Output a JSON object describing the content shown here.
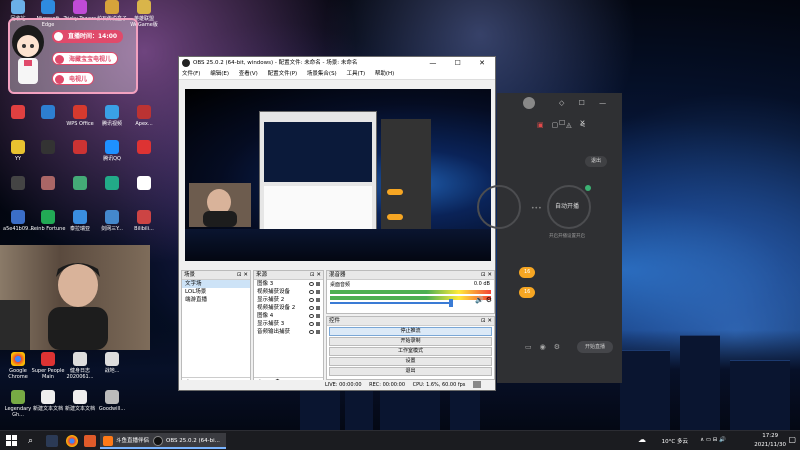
{
  "desktop": {
    "icons_col1": [
      "回收站",
      "",
      "",
      "",
      "",
      "",
      "",
      "",
      "",
      "Google Chrome",
      "Legendary Gh...",
      ""
    ],
    "icons_top": [
      {
        "label": "Microsoft Edge"
      },
      {
        "label": "Tricky Towers"
      },
      {
        "label": "炉石传说盒子"
      },
      {
        "label": "英雄联盟 WeGame版"
      },
      {
        "label": "...ubi"
      },
      {
        "label": "爱奇艺"
      },
      {
        "label": "CCleaner"
      },
      {
        "label": "同步下载客户端"
      },
      {
        "label": "打开机器"
      },
      {
        "label": "Ub..."
      }
    ],
    "icons_mid": [
      {
        "label": "WPS Office"
      },
      {
        "label": "腾讯视频"
      },
      {
        "label": "Apex..."
      },
      {
        "label": "YY"
      },
      {
        "label": "腾讯QQ"
      },
      {
        "label": "网易云..."
      },
      {
        "label": "炉石盒子"
      },
      {
        "label": "QQ音乐"
      },
      {
        "label": "a5e41b09..."
      },
      {
        "label": "Reinb Fortune"
      },
      {
        "label": "泰拉瑞亚"
      },
      {
        "label": "剑网三Y..."
      },
      {
        "label": "直播伴侣"
      },
      {
        "label": "Bilibili..."
      }
    ],
    "icons_bottom": [
      {
        "label": "Google Chrome"
      },
      {
        "label": "Super People Main"
      },
      {
        "label": "健身日志 2020061..."
      },
      {
        "label": "战地..."
      },
      {
        "label": "Legendary Gh..."
      },
      {
        "label": "新建文本文档"
      },
      {
        "label": "新建文本文档"
      },
      {
        "label": "Goodwill..."
      }
    ]
  },
  "overlay": {
    "time_text": "直播时间：14:00",
    "name_pill": "海藏宝宝电视儿",
    "sub_pill": "电视儿"
  },
  "obs": {
    "title": "OBS 25.0.2 (64-bit, windows) - 配置文件: 未命名 - 场景: 未命名",
    "menu": [
      "文件(F)",
      "编辑(E)",
      "查看(V)",
      "配置文件(P)",
      "场景集合(S)",
      "工具(T)",
      "帮助(H)"
    ],
    "scenes": {
      "title": "场景",
      "items": [
        "文字场",
        "LOL场景",
        "端游直播"
      ]
    },
    "sources": {
      "title": "来源",
      "items": [
        "图像 3",
        "视频捕获设备",
        "显示捕获 2",
        "视频捕获设备 2",
        "图像 4",
        "显示捕获 3",
        "音频输出捕获"
      ]
    },
    "mixer": {
      "title": "混音器",
      "track": "桌面音频",
      "db": "0.0 dB"
    },
    "controls": {
      "title": "控件",
      "buttons": [
        "停止推流",
        "开始录制",
        "工作室模式",
        "设置",
        "退出"
      ]
    },
    "status": {
      "live": "LIVE: 00:00:00",
      "rec": "REC: 00:00:00",
      "cpu": "CPU: 1.6%, 60.00 fps"
    }
  },
  "dark_app": {
    "exit_label": "退出",
    "auto_label": "自动开播",
    "pill1": "16",
    "pill2": "16",
    "left_caption": "",
    "right_caption": "开启开播设置开启",
    "live_button": "开始直播"
  },
  "taskbar": {
    "items": [
      {
        "label": "斗鱼直播伴侣"
      },
      {
        "label": "OBS 25.0.2 (64-bi..."
      }
    ],
    "weather": "10°C 多云",
    "time": "17:29",
    "date": "2021/11/30"
  },
  "colors": {
    "accent": "#f6a623",
    "pill_red": "#e04a6b",
    "pill_pink": "#f3a1c0"
  }
}
